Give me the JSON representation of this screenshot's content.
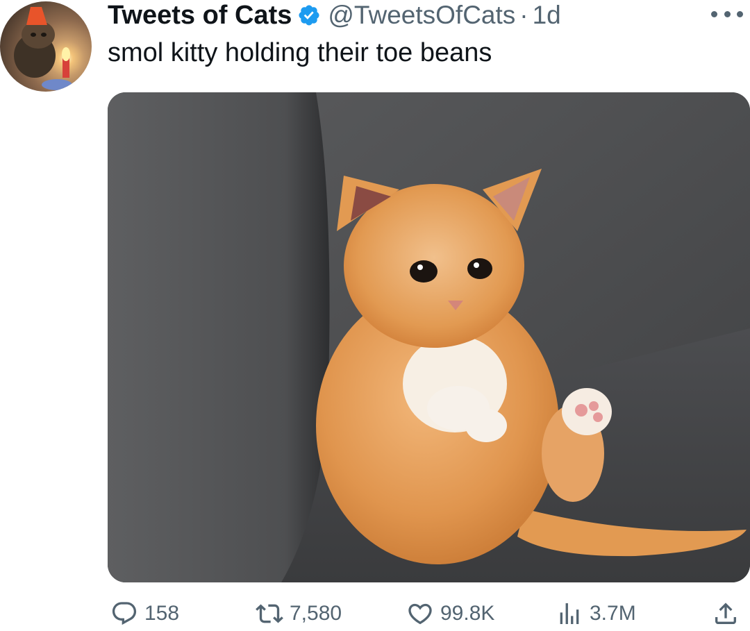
{
  "tweet": {
    "display_name": "Tweets of Cats",
    "handle": "@TweetsOfCats",
    "separator": "·",
    "time": "1d",
    "text": "smol kitty holding their toe beans",
    "verified": true
  },
  "stats": {
    "replies": "158",
    "retweets": "7,580",
    "likes": "99.8K",
    "views": "3.7M"
  },
  "icons": {
    "verified": "verified-badge-icon",
    "more": "more-icon",
    "reply": "reply-icon",
    "retweet": "retweet-icon",
    "like": "heart-icon",
    "views": "views-icon",
    "share": "share-icon"
  },
  "colors": {
    "verified_blue": "#1d9bf0",
    "text_primary": "#0f1419",
    "text_secondary": "#536471"
  }
}
